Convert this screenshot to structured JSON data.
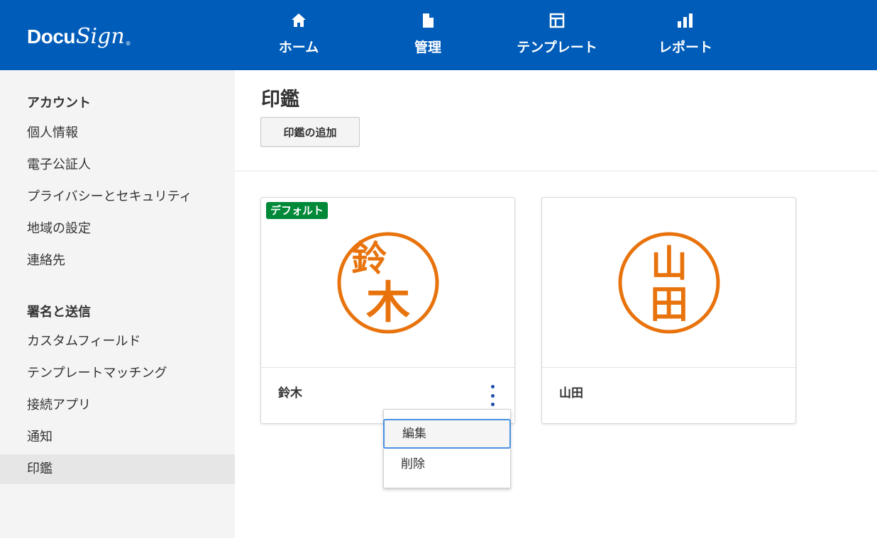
{
  "brand": {
    "docu": "Docu",
    "sign": "Sign",
    "reg": "®"
  },
  "nav": [
    {
      "label": "ホーム",
      "icon": "home-icon"
    },
    {
      "label": "管理",
      "icon": "document-icon"
    },
    {
      "label": "テンプレート",
      "icon": "template-icon"
    },
    {
      "label": "レポート",
      "icon": "bar-chart-icon"
    }
  ],
  "sidebar": {
    "section1_heading": "アカウント",
    "section1_items": [
      "個人情報",
      "電子公証人",
      "プライバシーとセキュリティ",
      "地域の設定",
      "連絡先"
    ],
    "section2_heading": "署名と送信",
    "section2_items": [
      "カスタムフィールド",
      "テンプレートマッチング",
      "接続アプリ",
      "通知",
      "印鑑"
    ],
    "active_item": "印鑑"
  },
  "main": {
    "title": "印鑑",
    "add_button": "印鑑の追加",
    "stamps": [
      {
        "name": "鈴木",
        "badge": "デフォルト",
        "seal_chars": [
          "鈴",
          "木"
        ]
      },
      {
        "name": "山田",
        "badge": "",
        "seal_chars": [
          "山",
          "田"
        ]
      }
    ],
    "context_menu": {
      "items": [
        "編集",
        "削除"
      ],
      "focused_index": 0
    }
  },
  "colors": {
    "header": "#005cb9",
    "badge": "#008938",
    "seal": "#e8730c",
    "kebab": "#1e4fa8",
    "focus": "#4a90e2"
  }
}
